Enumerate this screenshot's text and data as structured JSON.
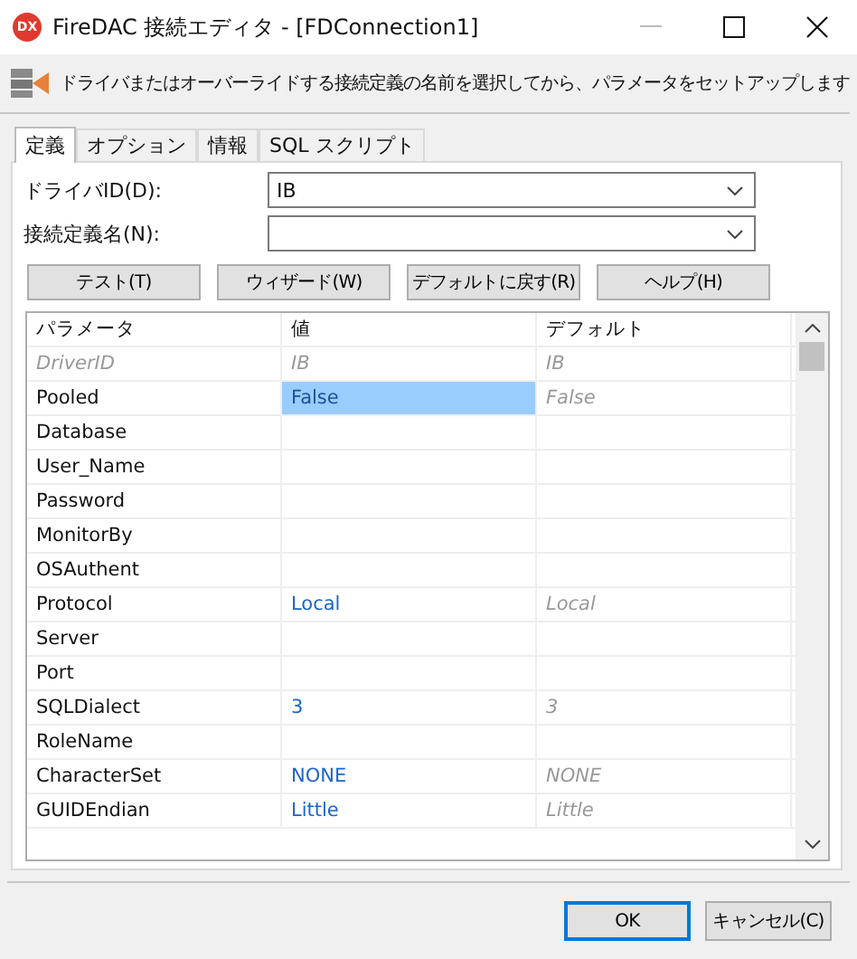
{
  "window": {
    "title": "FireDAC 接続エディタ - [FDConnection1]",
    "logo": "DX"
  },
  "header": {
    "text": "ドライバまたはオーバーライドする接続定義の名前を選択してから、パラメータをセットアップします"
  },
  "tabs": [
    {
      "label": "定義",
      "selected": true
    },
    {
      "label": "オプション",
      "selected": false
    },
    {
      "label": "情報",
      "selected": false
    },
    {
      "label": "SQL スクリプト",
      "selected": false
    }
  ],
  "fields": [
    {
      "label": "ドライバID(D):",
      "value": "IB"
    },
    {
      "label": "接続定義名(N):"
    }
  ],
  "actions": [
    "テスト(T)",
    "ウィザード(W)",
    "デフォルトに戻す(R)",
    "ヘルプ(H)"
  ],
  "grid": {
    "columns": [
      "パラメータ",
      "値",
      "デフォルト"
    ],
    "rows": [
      {
        "name": "DriverID",
        "value": "IB",
        "default": "IB",
        "selected": false,
        "disabled": true
      },
      {
        "name": "Pooled",
        "value": "False",
        "default": "False",
        "selected": true,
        "disabled": false
      },
      {
        "name": "Database",
        "selected": false,
        "disabled": false
      },
      {
        "name": "User_Name",
        "selected": false,
        "disabled": false
      },
      {
        "name": "Password",
        "selected": false,
        "disabled": false
      },
      {
        "name": "MonitorBy",
        "selected": false,
        "disabled": false
      },
      {
        "name": "OSAuthent",
        "selected": false,
        "disabled": false
      },
      {
        "name": "Protocol",
        "value": "Local",
        "default": "Local",
        "selected": false,
        "disabled": false
      },
      {
        "name": "Server",
        "selected": false,
        "disabled": false
      },
      {
        "name": "Port",
        "selected": false,
        "disabled": false
      },
      {
        "name": "SQLDialect",
        "value": "3",
        "default": "3",
        "selected": false,
        "disabled": false
      },
      {
        "name": "RoleName",
        "selected": false,
        "disabled": false
      },
      {
        "name": "CharacterSet",
        "value": "NONE",
        "default": "NONE",
        "selected": false,
        "disabled": false
      },
      {
        "name": "GUIDEndian",
        "value": "Little",
        "default": "Little",
        "selected": false,
        "disabled": false
      }
    ]
  },
  "buttons": [
    {
      "label": "OK",
      "focused": true
    },
    {
      "label": "キャンセル(C)",
      "focused": false
    }
  ]
}
